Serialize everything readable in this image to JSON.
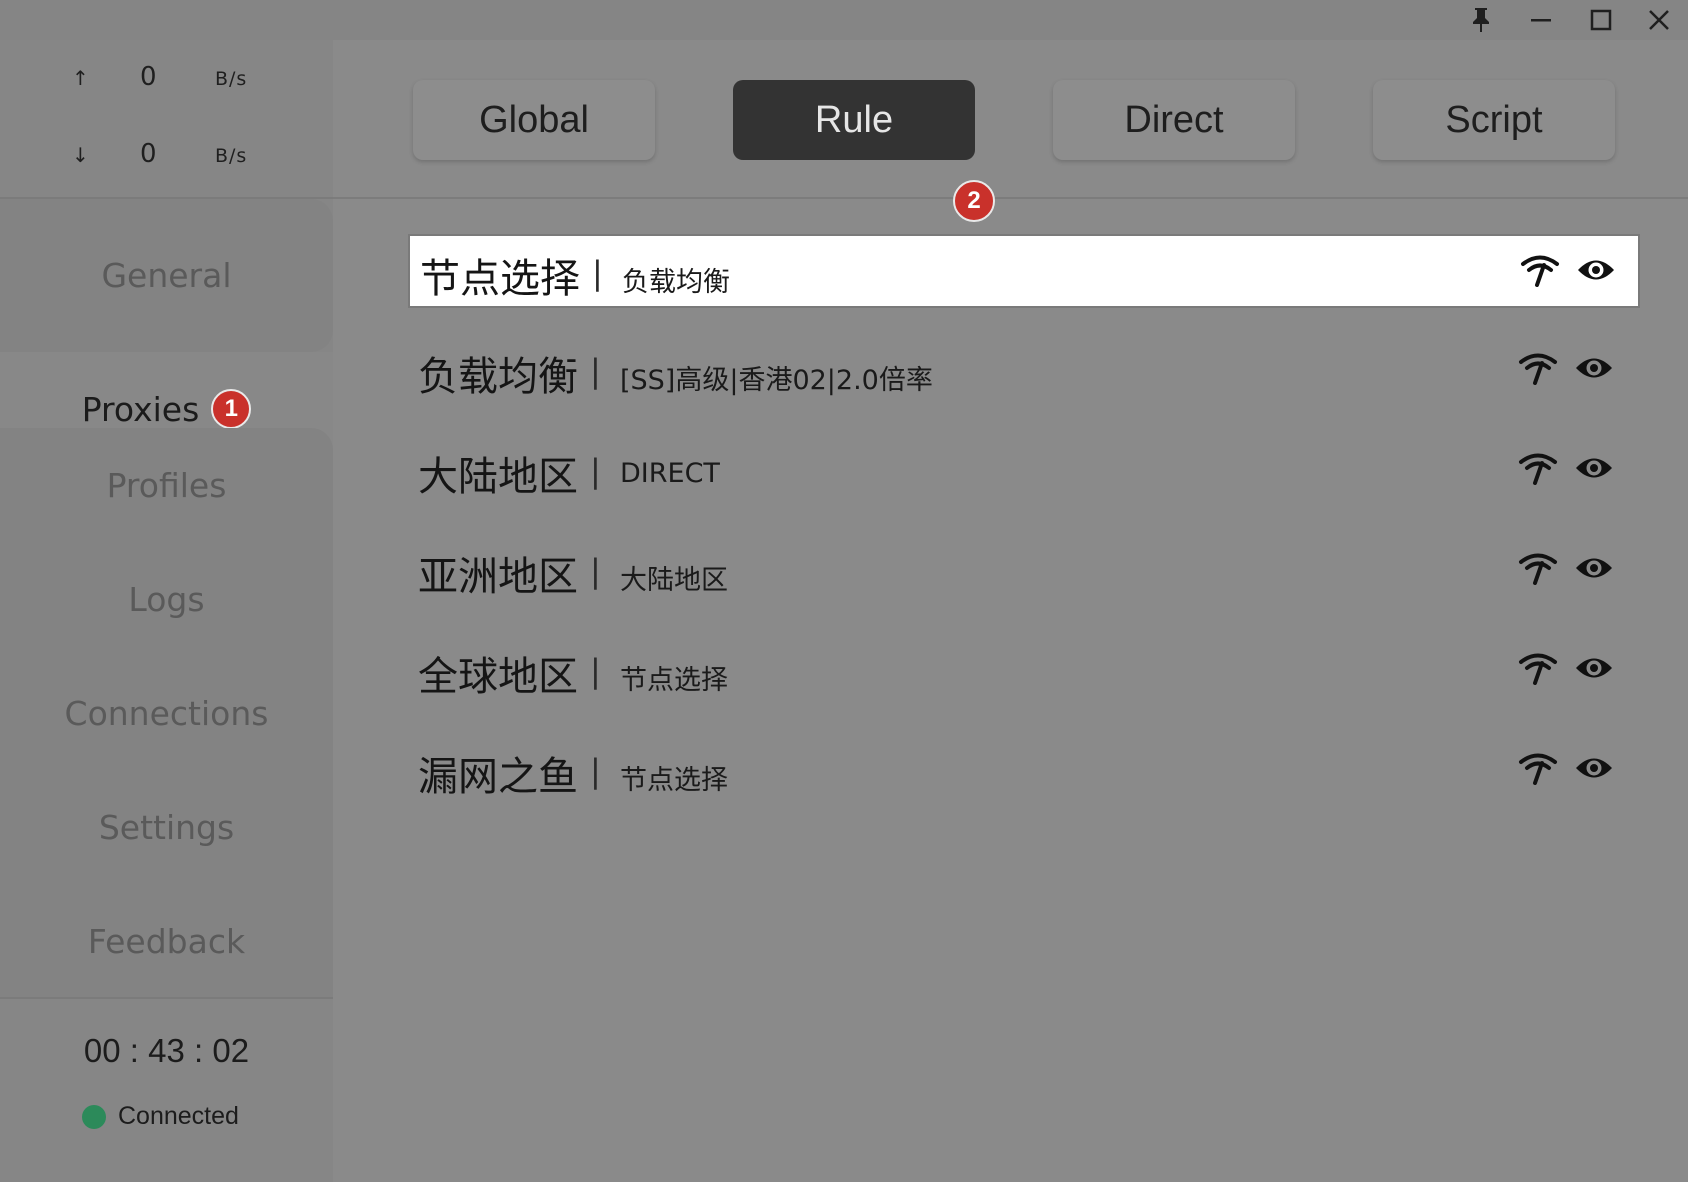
{
  "window": {
    "pin_icon": "pin-icon",
    "minimize_icon": "minimize-icon",
    "maximize_icon": "maximize-icon",
    "close_icon": "close-icon"
  },
  "traffic": {
    "upload": {
      "arrow": "↑",
      "value": "0",
      "unit": "B/s"
    },
    "download": {
      "arrow": "↓",
      "value": "0",
      "unit": "B/s"
    }
  },
  "nav": [
    {
      "label": "General"
    },
    {
      "label": "Proxies",
      "badge": "1",
      "active": true
    },
    {
      "label": "Profiles"
    },
    {
      "label": "Logs"
    },
    {
      "label": "Connections"
    },
    {
      "label": "Settings"
    },
    {
      "label": "Feedback"
    }
  ],
  "footer": {
    "timer": "00 : 43 : 02",
    "status": "Connected",
    "status_color": "#2c8a5a"
  },
  "modes": [
    {
      "label": "Global"
    },
    {
      "label": "Rule",
      "active": true
    },
    {
      "label": "Direct"
    },
    {
      "label": "Script"
    }
  ],
  "mode_badge": "2",
  "separator": "|",
  "groups": [
    {
      "name": "节点选择",
      "current": "负载均衡",
      "selected": true
    },
    {
      "name": "负载均衡",
      "current": "[SS]高级|香港02|2.0倍率"
    },
    {
      "name": "大陆地区",
      "current": "DIRECT"
    },
    {
      "name": "亚洲地区",
      "current": "大陆地区"
    },
    {
      "name": "全球地区",
      "current": "节点选择"
    },
    {
      "name": "漏网之鱼",
      "current": "节点选择"
    }
  ],
  "colors": {
    "accent_badge": "#c9312b",
    "active_mode_bg": "#333333"
  }
}
